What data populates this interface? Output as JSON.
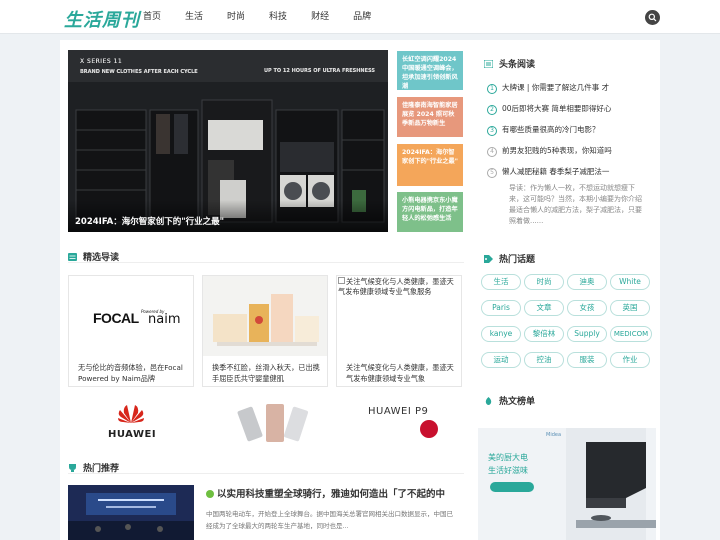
{
  "header": {
    "logo": "生活周刊",
    "nav": [
      "首页",
      "生活",
      "时尚",
      "科技",
      "财经",
      "品牌"
    ]
  },
  "hero": {
    "top_line1": "X SERIES 11",
    "top_line2": "BRAND NEW CLOTHES AFTER EACH CYCLE",
    "top_line3": "UP TO 12 HOURS OF ULTRA FRESHNESS",
    "caption": "2024IFA：海尔智家创下的\"行业之最\""
  },
  "tiles": [
    "长虹空调闪耀2024中国暖通空调峰会，坦承加速引领创新风潮",
    "佳隆泰南海智能家居展览 2024 照可秋季新品万物新生",
    "2024IFA：海尔智家创下的\"行业之最\"",
    "小熊电器携京东小魔方闪电新品，打造年轻人的松弛感生活"
  ],
  "featured": {
    "title": "精选导读",
    "cards": [
      {
        "text": "无与伦比的音频体验，邑在Focal Powered by Naim品牌",
        "logo": "FOCAL",
        "logo2": "Powered by",
        "logo3": "naim"
      },
      {
        "text": "换季不红脸，丝滑入秋天，已出携手屈臣氏共守婴童健肌"
      },
      {
        "alt": "关注气候变化与人类健康，墨迹天气发布健康领域专业气象服务",
        "text": "关注气候变化与人类健康，墨迹天气发布健康领域专业气象"
      }
    ]
  },
  "banner": {
    "brand1": "HUAWEI",
    "brand2": "HUAWEI",
    "model": "P9"
  },
  "hot": {
    "title": "热门推荐",
    "article_title": "以实用科技重塑全球骑行，雅迪如何造出「了不起的中",
    "article_desc": "中国两轮电动车，开始登上全球舞台。据中国海关总署官网相关出口数据显示，中国已经成为了全球最大的两轮车生产基地，同时也是..."
  },
  "headlines": {
    "title": "头条阅读",
    "items": [
      {
        "num": "1",
        "text": "大牌课 | 你需要了解这几件事 才"
      },
      {
        "num": "2",
        "text": "00后即将大赛 简单相要即得好心"
      },
      {
        "num": "3",
        "text": "有哪些质量很高的冷门电影？"
      },
      {
        "num": "4",
        "text": "前男友犯贱的5种表现，你知道吗"
      },
      {
        "num": "5",
        "text": "懒人减肥秘籍 春季梨子减肥法一"
      }
    ],
    "desc": "导读：作为懒人一枚，不想运动就想瘦下来，这可能吗？当然，本期小编要为你介绍最适合懒人的减肥方法，梨子减肥法，只要照着做......"
  },
  "topics": {
    "title": "热门话题",
    "tags": [
      "生活",
      "时尚",
      "迪奥",
      "White",
      "Paris",
      "文章",
      "女孩",
      "英国",
      "kanye",
      "黎倍林",
      "Supply",
      "MEDICOM",
      "运动",
      "控油",
      "服装",
      "作业"
    ]
  },
  "hotlist": {
    "title": "热文榜单",
    "ad_line1": "美的厨大电",
    "ad_line2": "生活好滋味",
    "ad_brand": "Midea"
  },
  "colors": {
    "accent": "#2aa89a",
    "tile1": "#6fc6c9",
    "tile2": "#e7987c",
    "tile3": "#f4a65a",
    "tile4": "#7ec08a"
  }
}
